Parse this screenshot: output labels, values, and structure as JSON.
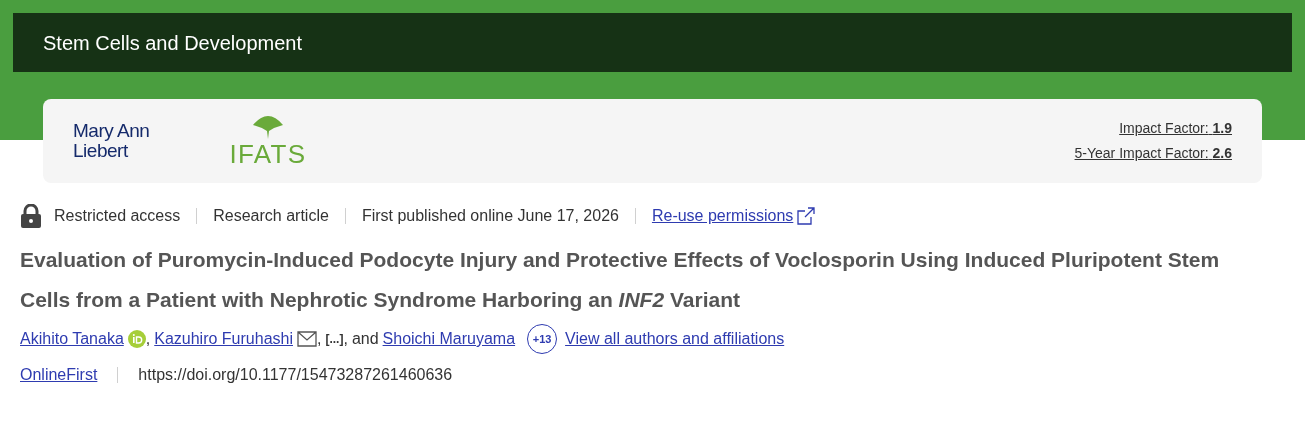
{
  "journal": {
    "title": "Stem Cells and Development"
  },
  "logos": {
    "publisher": [
      "Mary Ann",
      "Liebert"
    ],
    "society": "IFATS"
  },
  "metrics": [
    {
      "label": "Impact Factor:",
      "value": "1.9"
    },
    {
      "label": "5-Year Impact Factor:",
      "value": "2.6"
    }
  ],
  "meta": [
    {
      "kind": "access",
      "label": "Restricted access"
    },
    {
      "kind": "text",
      "label": "Research article"
    },
    {
      "kind": "text",
      "label": "First published online June 17, 2026"
    },
    {
      "kind": "link",
      "label": "Re-use permissions"
    }
  ],
  "article_title": "Evaluation of Puromycin-Induced Podocyte Injury and Protective Effects of Voclosporin Using Induced Pluripotent Stem Cells from a Patient with Nephrotic Syndrome Harboring an *INF2* Variant",
  "authors": [
    {
      "name": "Akihito Tanaka",
      "kind": "orcid"
    },
    {
      "name": "Kazuhiro Furuhashi",
      "kind": "email"
    }
  ],
  "separator": ",",
  "omitted": "[...]",
  "conjunction": "and",
  "last_author": {
    "name": "Shoichi Maruyama"
  },
  "more_count": "+13",
  "view_all": "View all authors and affiliations",
  "status": "OnlineFirst",
  "doi": "https://doi.org/10.1177/15473287261460636"
}
